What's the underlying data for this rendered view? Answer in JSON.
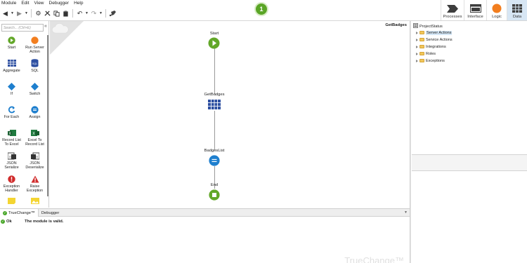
{
  "menu": [
    "Module",
    "Edit",
    "View",
    "Debugger",
    "Help"
  ],
  "version_badge": "1",
  "top_tabs": [
    {
      "label": "Processes",
      "icon": "processes-icon"
    },
    {
      "label": "Interface",
      "icon": "interface-icon"
    },
    {
      "label": "Logic",
      "icon": "logic-icon",
      "active": true
    },
    {
      "label": "Data",
      "icon": "data-icon"
    }
  ],
  "toolbox": {
    "search_placeholder": "Search... (Ctrl+E)",
    "items": [
      {
        "label": "Start",
        "icon": "start-icon"
      },
      {
        "label": "Run Server Action",
        "icon": "run-server-action-icon"
      },
      {
        "label": "Aggregate",
        "icon": "aggregate-icon"
      },
      {
        "label": "SQL",
        "icon": "sql-icon"
      },
      {
        "label": "If",
        "icon": "if-icon"
      },
      {
        "label": "Switch",
        "icon": "switch-icon"
      },
      {
        "label": "For Each",
        "icon": "for-each-icon"
      },
      {
        "label": "Assign",
        "icon": "assign-icon"
      },
      {
        "label": "Record List To Excel",
        "icon": "excel-export-icon"
      },
      {
        "label": "Excel To Record List",
        "icon": "excel-import-icon"
      },
      {
        "label": "JSON Serialize",
        "icon": "json-serialize-icon"
      },
      {
        "label": "JSON Deserialize",
        "icon": "json-deserialize-icon"
      },
      {
        "label": "Exception Handler",
        "icon": "exception-handler-icon"
      },
      {
        "label": "Raise Exception",
        "icon": "raise-exception-icon"
      },
      {
        "label": "",
        "icon": "comment-icon"
      },
      {
        "label": "",
        "icon": "image-icon"
      }
    ]
  },
  "canvas": {
    "title": "GetBadges",
    "nodes": [
      {
        "label": "Start",
        "icon": "start-node-icon"
      },
      {
        "label": "GetBadges",
        "icon": "aggregate-node-icon"
      },
      {
        "label": "BadgesList",
        "icon": "assign-node-icon"
      },
      {
        "label": "End",
        "icon": "end-node-icon"
      }
    ]
  },
  "tree": {
    "root": "ProjectStatus",
    "items": [
      "Server Actions",
      "Service Actions",
      "Integrations",
      "Roles",
      "Exceptions"
    ]
  },
  "bottom": {
    "tabs": [
      "TrueChange™",
      "Debugger"
    ],
    "messages": [
      {
        "status": "Ok",
        "text": "The module is valid."
      }
    ],
    "watermark": "TrueChange™"
  }
}
